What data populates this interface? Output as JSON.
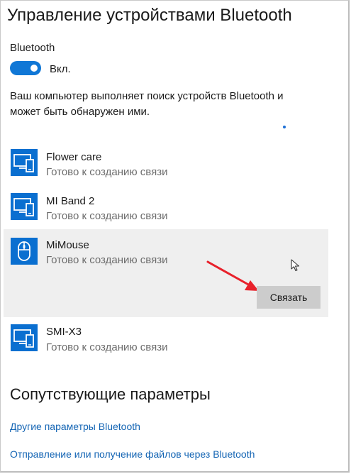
{
  "page": {
    "title": "Управление устройствами Bluetooth",
    "bluetooth_label": "Bluetooth",
    "toggle_state": "Вкл.",
    "description": "Ваш компьютер выполняет поиск устройств Bluetooth и может быть обнаружен ими."
  },
  "devices": [
    {
      "name": "Flower care",
      "status": "Готово к созданию связи",
      "icon": "computer-phone-icon"
    },
    {
      "name": "MI Band 2",
      "status": "Готово к созданию связи",
      "icon": "computer-phone-icon"
    },
    {
      "name": "MiMouse",
      "status": "Готово к созданию связи",
      "icon": "mouse-icon",
      "selected": true,
      "action": "Связать"
    },
    {
      "name": "SMI-X3",
      "status": "Готово к созданию связи",
      "icon": "computer-phone-icon"
    }
  ],
  "related": {
    "title": "Сопутствующие параметры",
    "links": [
      "Другие параметры Bluetooth",
      "Отправление или получение файлов через Bluetooth"
    ]
  },
  "colors": {
    "accent": "#0a6fd0",
    "link": "#1465b4",
    "annotation_arrow": "#e8212b",
    "selected_bg": "#efefef"
  }
}
